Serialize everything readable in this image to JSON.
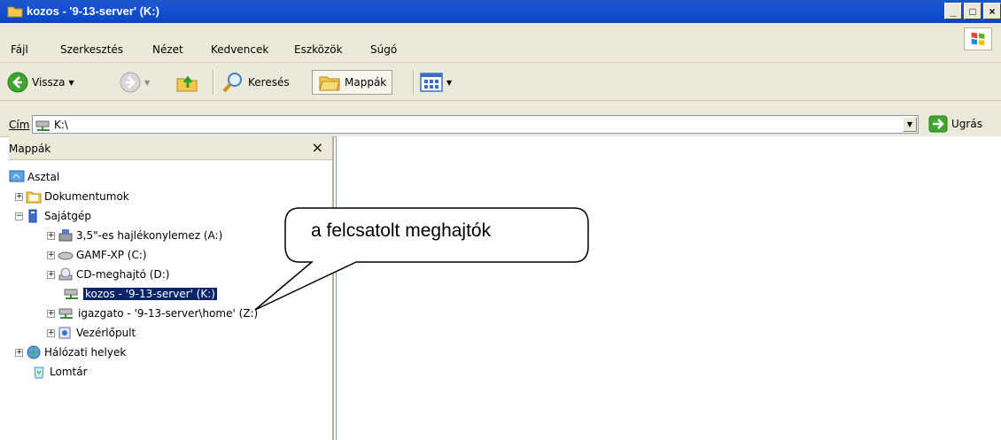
{
  "window": {
    "title": "kozos - '9-13-server' (K:)",
    "min_label": "_",
    "max_label": "□",
    "close_label": "×"
  },
  "menu": [
    {
      "label": "Fájl"
    },
    {
      "label": "Szerkesztés"
    },
    {
      "label": "Nézet"
    },
    {
      "label": "Kedvencek"
    },
    {
      "label": "Eszközök"
    },
    {
      "label": "Súgó"
    }
  ],
  "toolbar": {
    "back": "Vissza",
    "search": "Keresés",
    "folders": "Mappák"
  },
  "address": {
    "label": "Cím",
    "value": "K:\\",
    "go": "Ugrás"
  },
  "folders_pane": {
    "title": "Mappák",
    "close": "×",
    "items": [
      {
        "label": "Asztal"
      },
      {
        "label": "Dokumentumok"
      },
      {
        "label": "Sajátgép"
      },
      {
        "label": "3,5\"-es hajlékonylemez (A:)"
      },
      {
        "label": "GAMF-XP (C:)"
      },
      {
        "label": "CD-meghajtó (D:)"
      },
      {
        "label": "kozos - '9-13-server' (K:)"
      },
      {
        "label": "igazgato - '9-13-server\\home' (Z:)"
      },
      {
        "label": "Vezérlőpult"
      },
      {
        "label": "Hálózati helyek"
      },
      {
        "label": "Lomtár"
      }
    ]
  },
  "callout": {
    "text": "a felcsatolt meghajtók"
  },
  "colors": {
    "titlebar": "#0b46c3",
    "chrome": "#ece9d8",
    "selection": "#0a246a"
  }
}
